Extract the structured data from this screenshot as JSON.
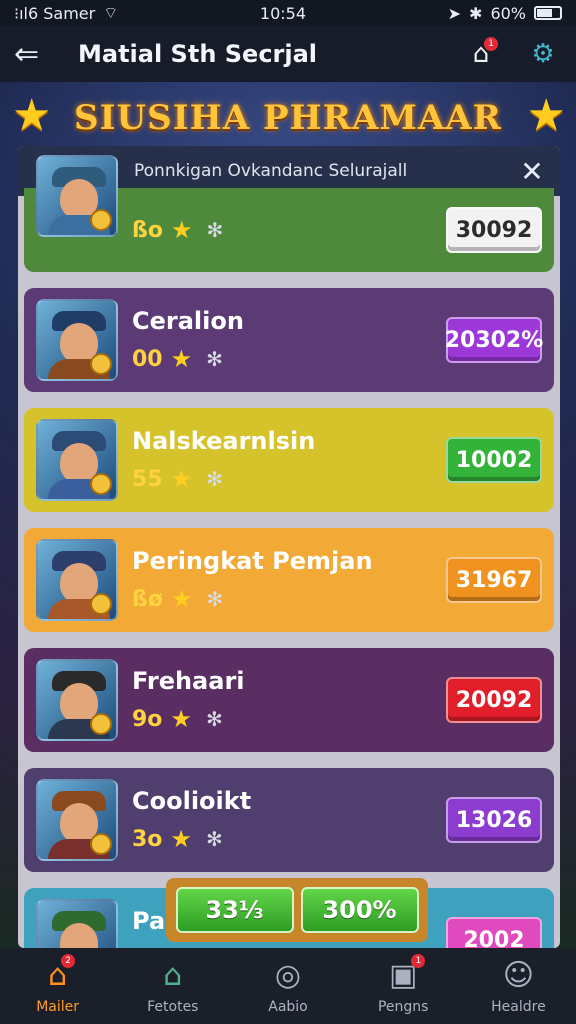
{
  "status": {
    "carrier": "⁝ıl6 Samer",
    "time": "10:54",
    "battery": "60%"
  },
  "appbar": {
    "title": "Matial Sth Secrjal",
    "back_icon": "back-arrow-icon",
    "bell_badge": "1",
    "gear_icon": "gear-icon"
  },
  "banner": {
    "title": "SIUSIHA PHRAMAAR"
  },
  "panel": {
    "header": "Ponnkigan Ovkandanc Selurajall"
  },
  "rows": [
    {
      "name": "",
      "meta": "ßo",
      "score": "30092",
      "color": "#4f8a3c",
      "button_color": "#f2f2f2"
    },
    {
      "name": "Ceralion",
      "meta": "00",
      "score": "20302%",
      "color": "#5b3a76",
      "button_color": "#9c38d8"
    },
    {
      "name": "Nalskearnlsin",
      "meta": "55",
      "score": "10002",
      "color": "#d6c22a",
      "button_color": "#34b33b"
    },
    {
      "name": "Peringkat Pemjan",
      "meta": "ßø",
      "score": "31967",
      "color": "#f2a935",
      "button_color": "#f0921f"
    },
    {
      "name": "Frehaari",
      "meta": "9o",
      "score": "20092",
      "color": "#5a2d63",
      "button_color": "#e01f2a"
    },
    {
      "name": "Coolioikt",
      "meta": "3o",
      "score": "13026",
      "color": "#4f3e6e",
      "button_color": "#8c3ccf"
    },
    {
      "name": "Pa",
      "meta": "",
      "score": "2002",
      "color": "#3ea2bf",
      "button_color": "#e04abf"
    }
  ],
  "pill": {
    "left": "33⅓",
    "right": "300%"
  },
  "nav": [
    {
      "label": "Mailer",
      "icon": "home-icon",
      "badge": "2",
      "active": true
    },
    {
      "label": "Fetotes",
      "icon": "house-icon",
      "badge": "",
      "active": false
    },
    {
      "label": "Aabio",
      "icon": "radio-icon",
      "badge": "",
      "active": false
    },
    {
      "label": "Pengns",
      "icon": "bag-icon",
      "badge": "1",
      "active": false
    },
    {
      "label": "Healdre",
      "icon": "profile-icon",
      "badge": "",
      "active": false
    }
  ]
}
